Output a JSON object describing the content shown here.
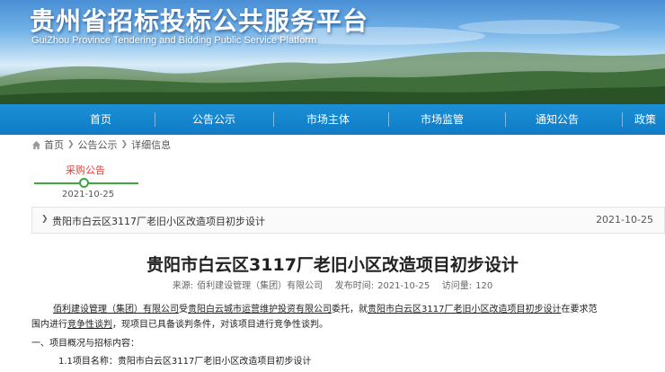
{
  "header": {
    "title": "贵州省招标投标公共服务平台",
    "subtitle": "GuiZhou Province Tendering and Bidding Public Service Platform"
  },
  "nav": {
    "items": [
      "首页",
      "公告公示",
      "市场主体",
      "市场监管",
      "通知公告",
      "政策"
    ]
  },
  "breadcrumb": {
    "items": [
      "首页",
      "公告公示",
      "详细信息"
    ]
  },
  "timeline": {
    "label": "采购公告",
    "date": "2021-10-25"
  },
  "notice_item": {
    "title": "贵阳市白云区3117厂老旧小区改造项目初步设计",
    "date": "2021-10-25"
  },
  "article": {
    "title": "贵阳市白云区3117厂老旧小区改造项目初步设计",
    "meta": {
      "source_label": "来源:",
      "source": "佰利建设管理（集团）有限公司",
      "time_label": "发布时间:",
      "time": "2021-10-25",
      "views_label": "访问量:",
      "views": "120"
    },
    "body": {
      "p1_seg1": "佰利建设管理（集团）有限公司",
      "p1_seg2": "受",
      "p1_seg3": "贵阳白云城市运营维护投资有限公司",
      "p1_seg4": "委托，就",
      "p1_seg5": "贵阳市白云区3117厂老旧小区改造项目初步设计",
      "p1_seg6": "在要求范",
      "p2_seg1": "围内进行",
      "p2_seg2": "竞争性谈判",
      "p2_seg3": "，现项目已具备谈判条件，对该项目进行竞争性谈判。",
      "section1": "一、项目概况与招标内容：",
      "item1_label": "1.1项目名称：",
      "item1_value": "贵阳市白云区3117厂老旧小区改造项目初步设计"
    }
  },
  "colors": {
    "nav_bg": "#1184cc",
    "accent_red": "#e0413a",
    "timeline_green": "#3aaa3a"
  }
}
